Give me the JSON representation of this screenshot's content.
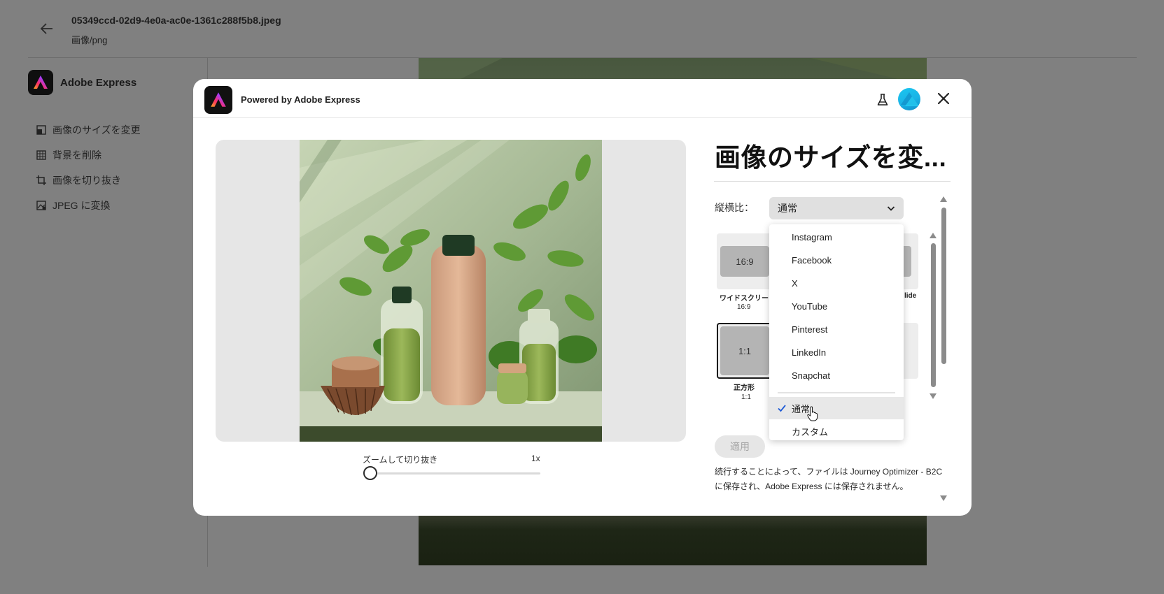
{
  "background": {
    "file_name": "05349ccd-02d9-4e0a-ac0e-1361c288f5b8.jpeg",
    "file_type": "画像/png",
    "brand": "Adobe Express",
    "menu": [
      {
        "label": "画像のサイズを変更",
        "icon": "resize-icon"
      },
      {
        "label": "背景を削除",
        "icon": "remove-background-icon"
      },
      {
        "label": "画像を切り抜き",
        "icon": "crop-icon"
      },
      {
        "label": "JPEG に変換",
        "icon": "convert-image-icon"
      }
    ]
  },
  "modal": {
    "title": "Powered by Adobe Express",
    "icons": [
      "flask-icon",
      "avatar",
      "close-icon"
    ],
    "zoom": {
      "label": "ズームして切り抜き",
      "value": "1x",
      "level": 0
    },
    "panel": {
      "title": "画像のサイズを変...",
      "aspect_label": "縦横比：",
      "aspect_value": "通常",
      "cards": [
        {
          "ratio_box": "16:9",
          "name": "ワイドスクリー",
          "ratio": "16:9"
        },
        {
          "ratio_box": "1:1",
          "name": "正方形",
          "ratio": "1:1"
        }
      ],
      "partial_card_label": "lide",
      "apply_label": "適用",
      "footnote": "続行することによって、ファイルは Journey Optimizer - B2C に保存され、Adobe Express には保存されません。"
    },
    "dropdown": {
      "options": [
        "Instagram",
        "Facebook",
        "X",
        "YouTube",
        "Pinterest",
        "LinkedIn",
        "Snapchat"
      ],
      "extra_options": [
        "通常",
        "カスタム"
      ],
      "selected": "通常"
    }
  },
  "colors": {
    "overlay": "#808080",
    "modal_bg": "#ffffff",
    "select_bg": "#e0e0e0",
    "avatar": "#1ab3e6"
  }
}
